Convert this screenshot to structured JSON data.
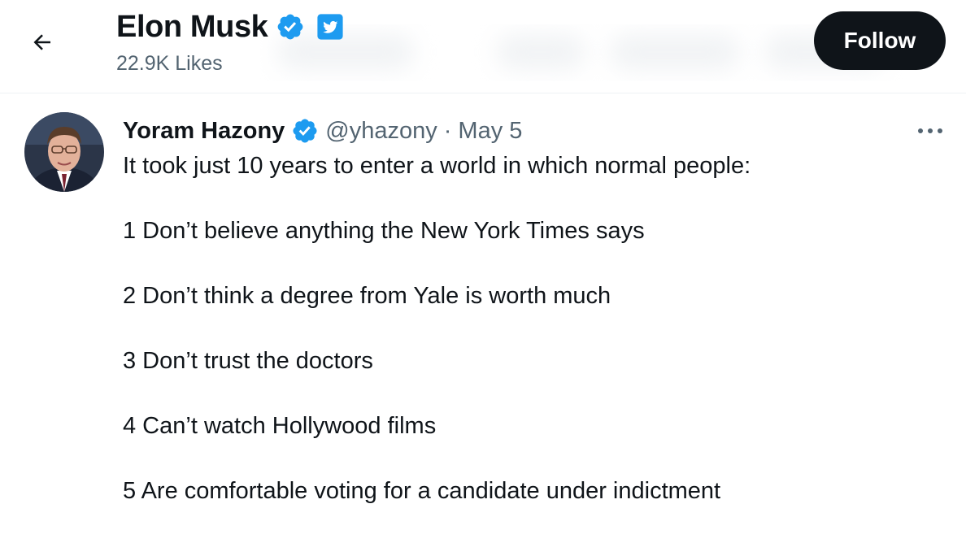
{
  "header": {
    "back_icon": "arrow-left-icon",
    "title": "Elon Musk",
    "verified_icon": "verified-badge-icon",
    "affiliate_icon": "twitter-bird-badge-icon",
    "subtitle": "22.9K Likes",
    "follow_label": "Follow"
  },
  "tweet": {
    "author_name": "Yoram Hazony",
    "handle": "@yhazony",
    "separator": "·",
    "date": "May 5",
    "more_icon": "more-horizontal-icon",
    "lines": [
      "It took just 10 years to enter a world in which normal people:",
      "1 Don’t believe anything the New York Times says",
      "2 Don’t think a degree from Yale is worth much",
      "3 Don’t trust the doctors",
      "4 Can’t watch Hollywood films",
      "5 Are comfortable voting for a candidate under indictment"
    ]
  },
  "colors": {
    "verified_blue": "#1d9bf0",
    "text_primary": "#0f1419",
    "text_secondary": "#536471",
    "follow_bg": "#0f1419"
  }
}
